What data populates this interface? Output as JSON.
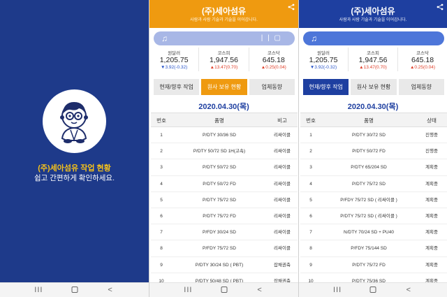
{
  "splash": {
    "title": "(주)세아섬유 작업 현황",
    "subtitle": "쉽고 간편하게 확인하세요."
  },
  "app": {
    "title": "(주)세아섬유",
    "slogan": "사람과 사람 기술과 기술을 이어갑니다."
  },
  "colors": {
    "splash_bg": "#1e3a8a",
    "orange_accent": "#ef9a10",
    "blue_accent": "#1e3fa0"
  },
  "tickers": [
    {
      "name": "원달러",
      "value": "1,205.75",
      "change": "▼3.92(-0.32)"
    },
    {
      "name": "코스피",
      "value": "1,947.56",
      "change": "▲13.47(0.70)"
    },
    {
      "name": "코스닥",
      "value": "645.18",
      "change": "▲0.25(0.04)"
    }
  ],
  "tabs": [
    "현재/향후 작업",
    "원사 보유 현황",
    "업체동향"
  ],
  "date": "2020.04.30(목)",
  "table2": {
    "headers": [
      "번호",
      "품명",
      "비고"
    ],
    "rows": [
      {
        "no": "1",
        "item": "P/DTY 30/36 SD",
        "note": "리싸이클"
      },
      {
        "no": "2",
        "item": "P/DTY 50/72 SD 1H(고속)",
        "note": "리싸이클"
      },
      {
        "no": "3",
        "item": "P/DTY 50/72 SD",
        "note": "리싸이클"
      },
      {
        "no": "4",
        "item": "P/DTY 50/72 FD",
        "note": "리싸이클"
      },
      {
        "no": "5",
        "item": "P/DTY 75/72 SD",
        "note": "리싸이클"
      },
      {
        "no": "6",
        "item": "P/DTY 75/72 FD",
        "note": "리싸이클"
      },
      {
        "no": "7",
        "item": "P/FDY 30/24 SD",
        "note": "리싸이클"
      },
      {
        "no": "8",
        "item": "P/FDY 75/72 SD",
        "note": "리싸이클"
      },
      {
        "no": "9",
        "item": "P/DTY 30/24 SD ( PBT)",
        "note": "잡채권축"
      },
      {
        "no": "10",
        "item": "P/DTY 50/48 SD ( PBT)",
        "note": "잡채권축"
      }
    ]
  },
  "table3": {
    "headers": [
      "번호",
      "품명",
      "상태"
    ],
    "rows": [
      {
        "no": "1",
        "item": "P/DTY 30/72 SD",
        "status": "진행중"
      },
      {
        "no": "2",
        "item": "P/DTY 50/72 FD",
        "status": "진행중"
      },
      {
        "no": "3",
        "item": "P/DTY 65/204 SD",
        "status": "계획중"
      },
      {
        "no": "4",
        "item": "P/DTY 75/72 SD",
        "status": "계획중"
      },
      {
        "no": "5",
        "item": "P/FDY 75/72 SD ( 리싸이클 )",
        "status": "계획중"
      },
      {
        "no": "6",
        "item": "P/DTY 75/72 SD ( 리싸이클 )",
        "status": "계획중"
      },
      {
        "no": "7",
        "item": "N/DTY 70/24 SD + PU40",
        "status": "계획중"
      },
      {
        "no": "8",
        "item": "P/FDY 75/144 SD",
        "status": "계획중"
      },
      {
        "no": "9",
        "item": "P/DTY 75/72 FD",
        "status": "계획중"
      },
      {
        "no": "10",
        "item": "P/DTY 75/36 SD",
        "status": "계획중"
      }
    ]
  }
}
